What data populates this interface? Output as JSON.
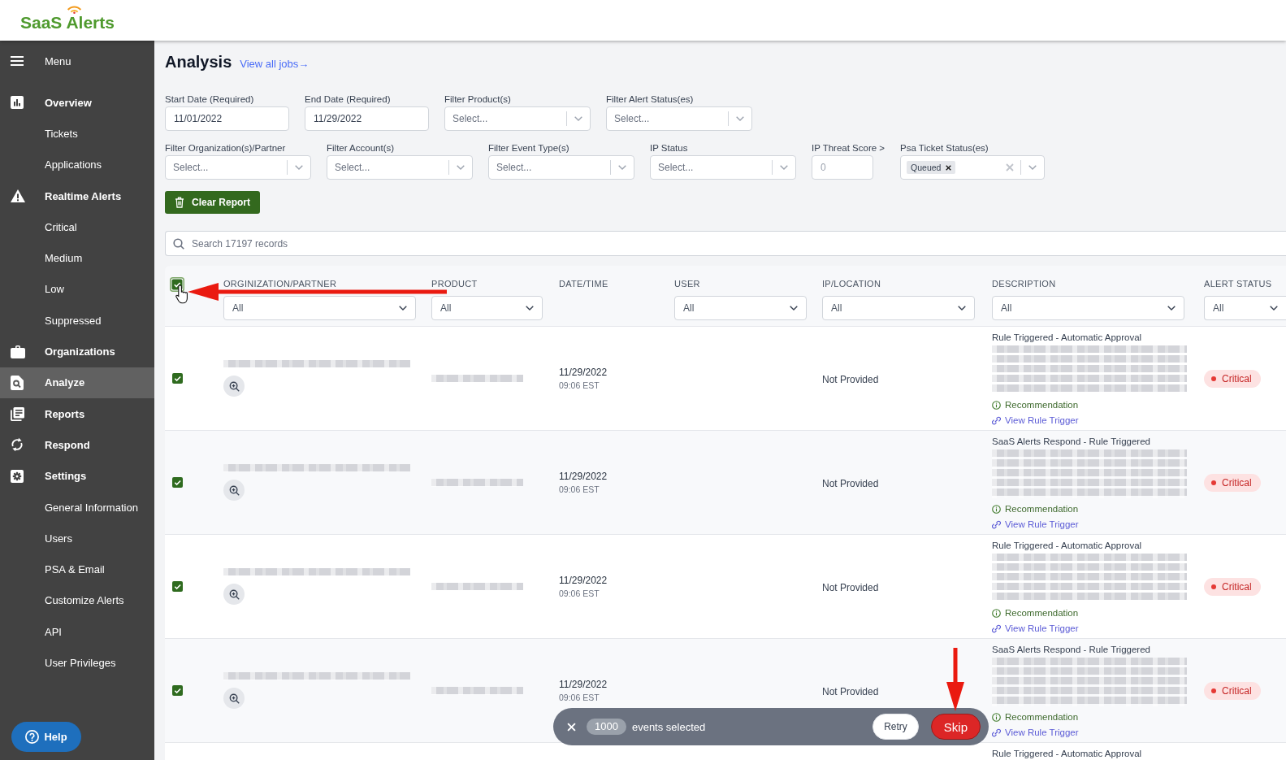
{
  "header": {
    "logo": "SaaS Alerts"
  },
  "sidebar": {
    "menu_label": "Menu",
    "sections": [
      {
        "label": "Overview",
        "selected": false,
        "children": [
          {
            "label": "Tickets",
            "selected": false
          },
          {
            "label": "Applications",
            "selected": false
          }
        ]
      },
      {
        "label": "Realtime Alerts",
        "selected": false,
        "children": [
          {
            "label": "Critical",
            "selected": false
          },
          {
            "label": "Medium",
            "selected": false
          },
          {
            "label": "Low",
            "selected": false
          },
          {
            "label": "Suppressed",
            "selected": false
          }
        ]
      },
      {
        "label": "Organizations",
        "selected": false
      },
      {
        "label": "Analyze",
        "selected": true
      },
      {
        "label": "Reports",
        "selected": false
      },
      {
        "label": "Respond",
        "selected": false
      },
      {
        "label": "Settings",
        "selected": false,
        "children": [
          {
            "label": "General Information",
            "selected": false
          },
          {
            "label": "Users",
            "selected": false
          },
          {
            "label": "PSA & Email",
            "selected": false
          },
          {
            "label": "Customize Alerts",
            "selected": false
          },
          {
            "label": "API",
            "selected": false
          },
          {
            "label": "User Privileges",
            "selected": false
          }
        ]
      }
    ],
    "help_button": "Help"
  },
  "page": {
    "title": "Analysis",
    "link": "View all jobs→"
  },
  "filter_rows": [
    [
      {
        "kind": "date",
        "label": "Start Date (Required)",
        "value": "11/01/2022"
      },
      {
        "kind": "date",
        "label": "End Date (Required)",
        "value": "11/29/2022"
      },
      {
        "kind": "select",
        "label": "Filter Product(s)",
        "placeholder": "Select..."
      },
      {
        "kind": "select",
        "label": "Filter Alert Status(es)",
        "placeholder": "Select..."
      }
    ],
    [
      {
        "kind": "select",
        "label": "Filter Organization(s)/Partner",
        "placeholder": "Select..."
      },
      {
        "kind": "select",
        "label": "Filter Account(s)",
        "placeholder": "Select..."
      },
      {
        "kind": "select",
        "label": "Filter Event Type(s)",
        "placeholder": "Select..."
      },
      {
        "kind": "select",
        "label": "IP Status",
        "placeholder": "Select..."
      },
      {
        "kind": "number",
        "label": "IP Threat Score >",
        "placeholder": "0"
      },
      {
        "kind": "multiselect",
        "label": "Psa Ticket Status(es)",
        "tags": [
          "Queued"
        ]
      }
    ]
  ],
  "clear_button": "Clear Report",
  "search": {
    "placeholder": "Search 17197 records"
  },
  "table": {
    "select_all": {
      "checked": true
    },
    "columns": [
      {
        "label": "ORGINIZATION/PARTNER",
        "filter": "All"
      },
      {
        "label": "PRODUCT",
        "filter": "All"
      },
      {
        "label": "DATE/TIME"
      },
      {
        "label": "USER",
        "filter": "All"
      },
      {
        "label": "IP/LOCATION",
        "filter": "All"
      },
      {
        "label": "DESCRIPTION",
        "filter": "All"
      },
      {
        "label": "ALERT STATUS",
        "filter": "All"
      }
    ],
    "rows": [
      {
        "checked": true,
        "org_redacted": true,
        "product_redacted": true,
        "date": "11/29/2022",
        "time": "09:06 EST",
        "ip_location": "Not Provided",
        "description": {
          "title": "Rule Triggered - Automatic Approval",
          "redacted": true,
          "recommendation": "Recommendation",
          "link": "View Rule Trigger"
        },
        "alert_status": "Critical"
      },
      {
        "checked": true,
        "org_redacted": true,
        "product_redacted": true,
        "date": "11/29/2022",
        "time": "09:06 EST",
        "ip_location": "Not Provided",
        "description": {
          "title": "SaaS Alerts Respond - Rule Triggered",
          "redacted": true,
          "recommendation": "Recommendation",
          "link": "View Rule Trigger"
        },
        "alert_status": "Critical"
      },
      {
        "checked": true,
        "org_redacted": true,
        "product_redacted": true,
        "date": "11/29/2022",
        "time": "09:06 EST",
        "ip_location": "Not Provided",
        "description": {
          "title": "Rule Triggered - Automatic Approval",
          "redacted": true,
          "recommendation": "Recommendation",
          "link": "View Rule Trigger"
        },
        "alert_status": "Critical"
      },
      {
        "checked": true,
        "org_redacted": true,
        "product_redacted": true,
        "date": "11/29/2022",
        "time": "09:06 EST",
        "ip_location": "Not Provided",
        "description": {
          "title": "SaaS Alerts Respond - Rule Triggered",
          "redacted": true,
          "recommendation": "Recommendation",
          "link": "View Rule Trigger"
        },
        "alert_status": "Critical"
      },
      {
        "description": {
          "title": "Rule Triggered - Automatic Approval"
        }
      }
    ]
  },
  "selection_bar": {
    "count": "1000",
    "label": "events selected",
    "buttons": [
      {
        "label": "Retry",
        "kind": "secondary"
      },
      {
        "label": "Skip",
        "kind": "danger"
      }
    ]
  }
}
